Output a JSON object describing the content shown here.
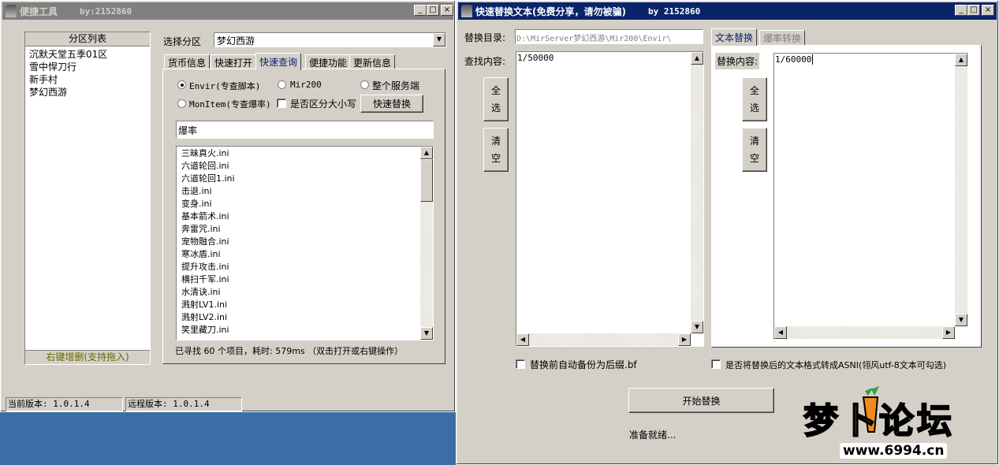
{
  "left_window": {
    "title": "便捷工具",
    "author": "by:2152860",
    "controls": [
      "_",
      "□",
      "×"
    ],
    "zone_list": {
      "header": "分区列表",
      "items": [
        "沉默天堂五季01区",
        "雪中悍刀行",
        "新手村",
        "梦幻西游"
      ],
      "footer": "右键增删(支持拖入)"
    },
    "select_zone_label": "选择分区",
    "select_zone_value": "梦幻西游",
    "tabs": [
      "货币信息",
      "快速打开",
      "快速查询",
      "便捷功能",
      "更新信息"
    ],
    "selected_tab": "快速查询",
    "radios": {
      "envir": "Envir(专查脚本)",
      "mir200": "Mir200",
      "whole_server": "整个服务端",
      "monitem": "MonItem(专查爆率)"
    },
    "case_checkbox": "是否区分大小写",
    "quick_replace_button": "快速替换",
    "search_value": "爆率",
    "results": [
      "三昧真火.ini",
      "六道轮回.ini",
      "六道轮回1.ini",
      "击退.ini",
      "变身.ini",
      "基本箭术.ini",
      "奔雷咒.ini",
      "宠物融合.ini",
      "寒冰盾.ini",
      "提升攻击.ini",
      "横扫千军.ini",
      "水清诀.ini",
      "溅射LV1.ini",
      "溅射LV2.ini",
      "笑里藏刀.ini"
    ],
    "result_status": "已寻找 60 个项目，耗时: 579ms （双击打开或右键操作）",
    "current_version": "当前版本: 1.0.1.4",
    "remote_version": "远程版本: 1.0.1.4"
  },
  "right_window": {
    "title": "快速替换文本(免费分享，请勿被骗)",
    "author": "by 2152860",
    "controls": [
      "_",
      "□",
      "×"
    ],
    "replace_dir_label": "替换目录:",
    "replace_dir_value": "D:\\MirServer梦幻西游\\Mir200\\Envir\\",
    "find_label": "查找内容:",
    "find_value": "1/50000",
    "select_all": "全\n选",
    "clear": "清\n空",
    "tabs": [
      "文本替换",
      "爆率转换"
    ],
    "selected_tab": "文本替换",
    "replace_label": "替换内容:",
    "replace_value": "1/60000",
    "backup_checkbox": "替换前自动备份为后缀.bf",
    "ansi_checkbox": "是否将替换后的文本格式转成ASNI(翎风utf-8文本可勾选)",
    "start_button": "开始替换",
    "status": "准备就绪..."
  },
  "watermark": {
    "logo_text": "梦卜论坛",
    "url": "www.6994.cn"
  },
  "colors": {
    "desktop": "#3a6ea5",
    "window_face": "#d4d0c8",
    "active_title": "#0a246a",
    "inactive_title": "#808080",
    "footer_text": "#6b6b00",
    "logo_fill": "#f5c400"
  }
}
